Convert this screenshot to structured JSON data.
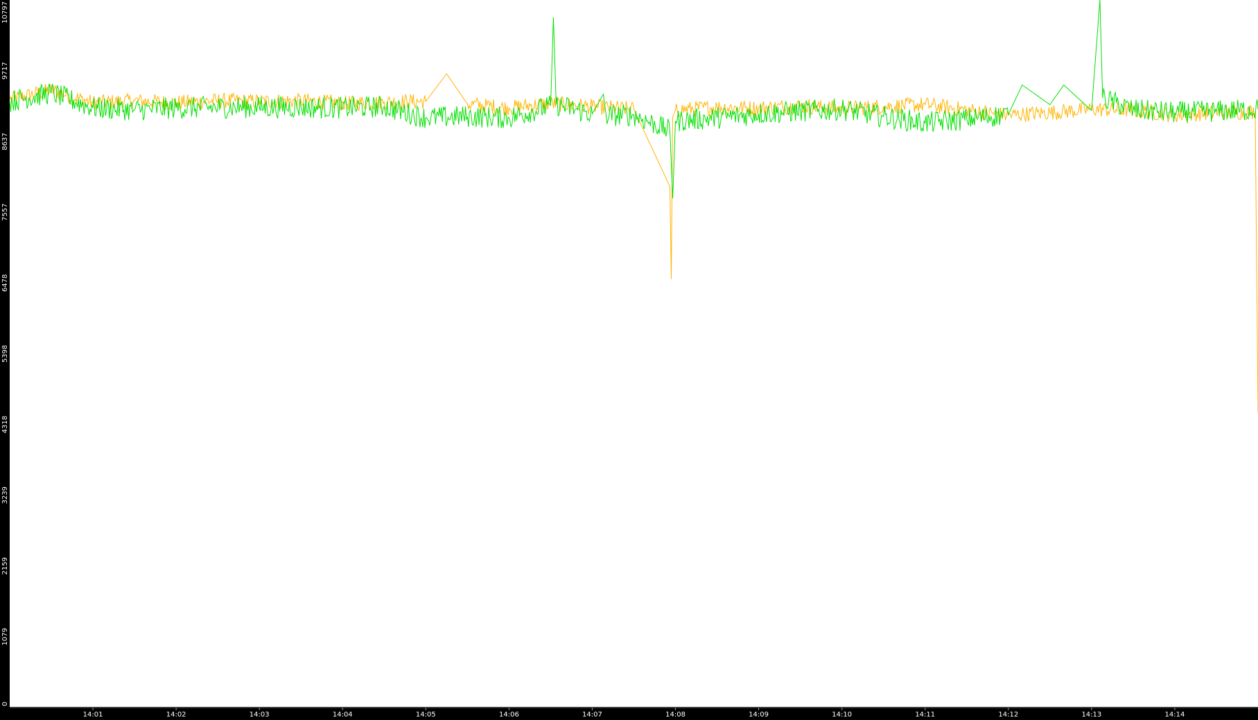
{
  "chart_data": {
    "type": "line",
    "title": "",
    "xlabel": "",
    "ylabel": "",
    "ylim": [
      0,
      10797
    ],
    "y_ticks": [
      "0",
      "1079",
      "2159",
      "3239",
      "4318",
      "5398",
      "6478",
      "7557",
      "8637",
      "9717",
      "10797"
    ],
    "x_ticks": [
      "14:01",
      "14:02",
      "14:03",
      "14:04",
      "14:05",
      "14:06",
      "14:07",
      "14:08",
      "14:09",
      "14:10",
      "14:11",
      "14:12",
      "14:13",
      "14:14"
    ],
    "x_range": [
      "14:00:00",
      "14:15:00"
    ],
    "grid": false,
    "legend": "none",
    "colors": {
      "background": "#ffffff",
      "axis_band": "#000000",
      "tick_text": "#ffffff",
      "series_orange": "#ffb400",
      "series_green": "#00e000"
    },
    "series": [
      {
        "color": "#ffb400",
        "x": [
          "14:00:00",
          "14:00:30",
          "14:01:00",
          "14:01:30",
          "14:02:00",
          "14:02:30",
          "14:03:00",
          "14:03:30",
          "14:04:00",
          "14:04:30",
          "14:05:00",
          "14:05:15",
          "14:05:30",
          "14:06:00",
          "14:06:30",
          "14:07:00",
          "14:07:30",
          "14:07:56",
          "14:07:57",
          "14:07:58",
          "14:08:00",
          "14:08:30",
          "14:09:00",
          "14:09:30",
          "14:10:00",
          "14:10:30",
          "14:11:00",
          "14:11:30",
          "14:12:00",
          "14:12:30",
          "14:13:00",
          "14:13:30",
          "14:14:00",
          "14:14:30",
          "14:14:58",
          "14:15:00"
        ],
        "values": [
          9280,
          9420,
          9230,
          9260,
          9230,
          9260,
          9250,
          9260,
          9220,
          9240,
          9250,
          9670,
          9210,
          9150,
          9220,
          9170,
          9130,
          7950,
          6540,
          9010,
          9120,
          9160,
          9150,
          9180,
          9140,
          9170,
          9200,
          9120,
          9040,
          9080,
          9130,
          9120,
          9040,
          9080,
          9090,
          4500
        ]
      },
      {
        "color": "#00e000",
        "x": [
          "14:00:00",
          "14:00:30",
          "14:01:00",
          "14:01:30",
          "14:02:00",
          "14:02:30",
          "14:03:00",
          "14:03:30",
          "14:04:00",
          "14:04:30",
          "14:05:00",
          "14:05:30",
          "14:06:00",
          "14:06:30",
          "14:06:32",
          "14:06:34",
          "14:07:00",
          "14:07:08",
          "14:07:10",
          "14:07:30",
          "14:07:56",
          "14:07:58",
          "14:08:00",
          "14:08:30",
          "14:09:00",
          "14:09:30",
          "14:10:00",
          "14:10:30",
          "14:11:00",
          "14:11:30",
          "14:12:00",
          "14:12:10",
          "14:12:30",
          "14:12:40",
          "14:13:00",
          "14:13:06",
          "14:13:08",
          "14:13:30",
          "14:14:00",
          "14:14:30",
          "14:15:00"
        ],
        "values": [
          9250,
          9380,
          9150,
          9120,
          9150,
          9160,
          9160,
          9160,
          9150,
          9170,
          9000,
          9020,
          9000,
          9180,
          10530,
          9200,
          9060,
          9360,
          9040,
          9040,
          8800,
          7770,
          8950,
          9000,
          9060,
          9100,
          9130,
          9020,
          8920,
          8980,
          9050,
          9500,
          9200,
          9500,
          9110,
          10797,
          9300,
          9120,
          9080,
          9100,
          9130
        ]
      }
    ]
  }
}
